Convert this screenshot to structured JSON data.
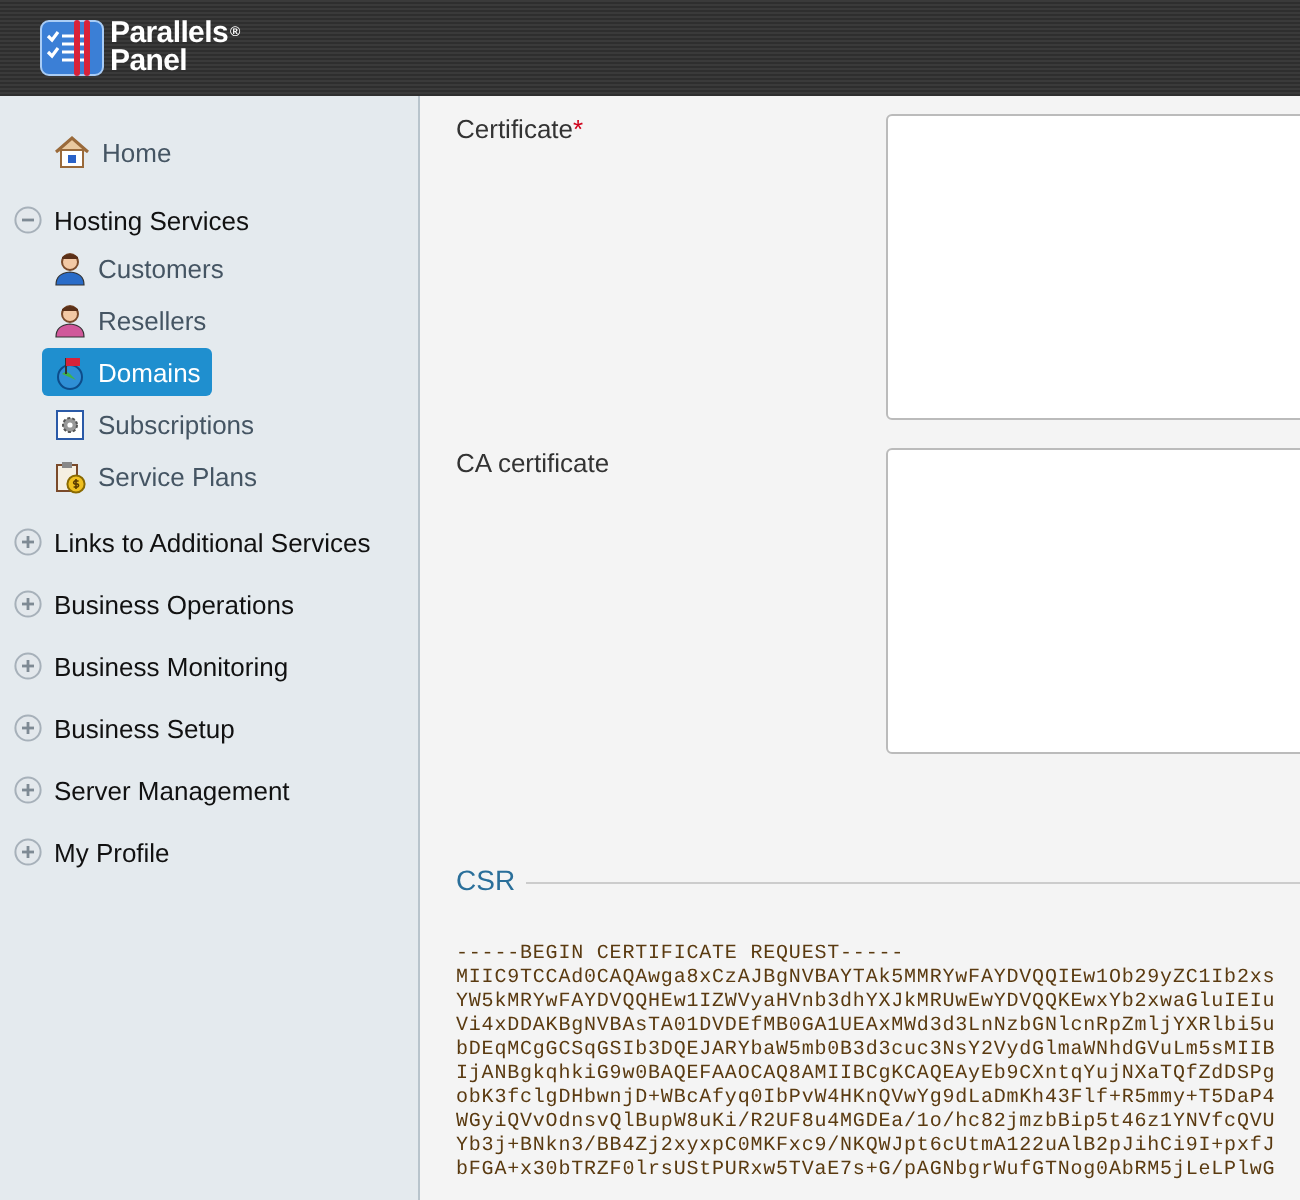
{
  "header": {
    "logo": {
      "line1": "Parallels",
      "registered": "®",
      "line2": "Panel"
    }
  },
  "sidebar": {
    "home": {
      "label": "Home"
    },
    "sections": [
      {
        "label": "Hosting Services",
        "expanded": true,
        "children": [
          {
            "label": "Customers",
            "kind": "customer",
            "selected": false
          },
          {
            "label": "Resellers",
            "kind": "reseller",
            "selected": false
          },
          {
            "label": "Domains",
            "kind": "domain",
            "selected": true
          },
          {
            "label": "Subscriptions",
            "kind": "subscription",
            "selected": false
          },
          {
            "label": "Service Plans",
            "kind": "plan",
            "selected": false
          }
        ]
      },
      {
        "label": "Links to Additional Services",
        "expanded": false
      },
      {
        "label": "Business Operations",
        "expanded": false
      },
      {
        "label": "Business Monitoring",
        "expanded": false
      },
      {
        "label": "Business Setup",
        "expanded": false
      },
      {
        "label": "Server Management",
        "expanded": false
      },
      {
        "label": "My Profile",
        "expanded": false
      }
    ]
  },
  "form": {
    "fields": [
      {
        "label": "Certificate",
        "required_mark": "*"
      },
      {
        "label": "CA certificate"
      }
    ],
    "csr": {
      "title": "CSR",
      "lines": [
        "-----BEGIN CERTIFICATE REQUEST-----",
        "MIIC9TCCAd0CAQAwga8xCzAJBgNVBAYTAk5MMRYwFAYDVQQIEw1Ob29yZC1Ib2xs",
        "YW5kMRYwFAYDVQQHEw1IZWVyaHVnb3dhYXJkMRUwEwYDVQQKEwxYb2xwaGluIEIu",
        "Vi4xDDAKBgNVBAsTA01DVDEfMB0GA1UEAxMWd3d3LnNzbGNlcnRpZmljYXRlbi5u",
        "bDEqMCgGCSqGSIb3DQEJARYbaW5mb0B3d3cuc3NsY2VydGlmaWNhdGVuLm5sMIIB",
        "IjANBgkqhkiG9w0BAQEFAAOCAQ8AMIIBCgKCAQEAyEb9CXntqYujNXaTQfZdDSPg",
        "obK3fclgDHbwnjD+WBcAfyq0IbPvW4HKnQVwYg9dLaDmKh43Flf+R5mmy+T5DaP4",
        "WGyiQVvOdnsvQlBupW8uKi/R2UF8u4MGDEa/1o/hc82jmzbBip5t46z1YNVfcQVU",
        "Yb3j+BNkn3/BB4Zj2xyxpC0MKFxc9/NKQWJpt6cUtmA122uAlB2pJihCi9I+pxfJ",
        "bFGA+x30bTRZF0lrsUStPURxw5TVaE7s+G/pAGNbgrWufGTNog0AbRM5jLeLPlwG"
      ]
    }
  }
}
